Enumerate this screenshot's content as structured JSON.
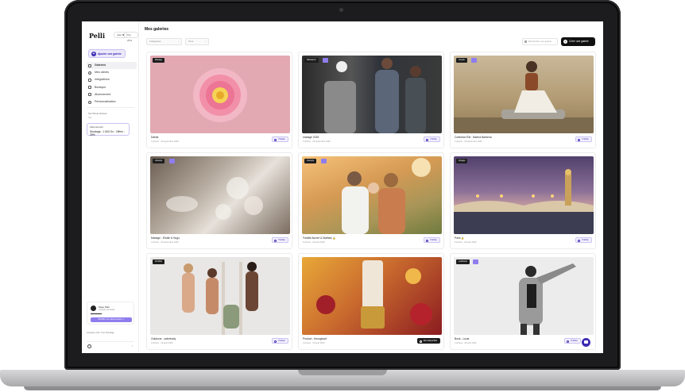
{
  "app": {
    "logo": "Pelli",
    "badge_1": "Aide ✱",
    "badge_2": "Top 25%"
  },
  "sidebar": {
    "add_gallery_label": "Ajouter une galerie",
    "items": [
      {
        "label": "Galeries",
        "icon": "gallery-icon",
        "active": true
      },
      {
        "label": "Mes clients",
        "icon": "users-icon",
        "active": false
      },
      {
        "label": "Intégrations",
        "icon": "plug-icon",
        "active": false
      },
      {
        "label": "Boutique",
        "icon": "shop-icon",
        "active": false
      },
      {
        "label": "Abonnement",
        "icon": "card-icon",
        "active": false
      },
      {
        "label": "Personnalisation",
        "icon": "palette-icon",
        "active": false
      }
    ],
    "storage_label": "Sur Photo Stories",
    "storage_value": "32 /",
    "plan_title": "Abonnement",
    "plan_text": "Stockage : 1 600 Go · Offres : 25%",
    "user_name": "Pepe Pelli",
    "user_sub": "Compte connecté",
    "upgrade_label": "Modifier mon abonnement ↗",
    "footer_text": "Accepter votre 1 Go Stockage",
    "help_chevron": "›"
  },
  "main": {
    "page_title": "Mes galeries",
    "filter_1": "Catégories",
    "filter_2": "Tous",
    "search_placeholder": "Rechercher une galerie",
    "create_label": "Créer une galerie"
  },
  "galleries": [
    {
      "title": "Dahlia",
      "meta": "4 photos · 19 septembre 2025",
      "tag": "Mariage",
      "status": "Publiée",
      "dark": false
    },
    {
      "title": "mariage 2025",
      "meta": "2 photos · 18 septembre 2025",
      "tag": "Naissance",
      "status": "Publiée",
      "dark": false
    },
    {
      "title": "Collection Été - Barbra Barbena",
      "meta": "4 photos · 18 septembre 2025",
      "tag": "Couple",
      "status": "Publiée",
      "dark": false
    },
    {
      "title": "Mariage - Élodie & Hugo",
      "meta": "4 photos · 18 septembre 2025",
      "tag": "Lifestyle",
      "status": "Publiée",
      "dark": false
    },
    {
      "title": "Famille Aurore & Mathieu 🔒",
      "meta": "6 photos · 18 août 2025",
      "tag": "Lifestyle",
      "status": "Publiée",
      "dark": false
    },
    {
      "title": "Paris 🔒",
      "meta": "6 photos · 28 août 2025",
      "tag": "Voyage",
      "status": "Publiée",
      "dark": false
    },
    {
      "title": "Outdoors - swimbody",
      "meta": "2 photos · 19 août 2025",
      "tag": "Portfolio",
      "status": "Publiée",
      "dark": false
    },
    {
      "title": "Product - throughout",
      "meta": "2 photos · 18 août 2025",
      "tag": "",
      "status": "Non-disponible",
      "dark": true
    },
    {
      "title": "Book - Lucia",
      "meta": "4 photos · 18 août 2025",
      "tag": "Lookbook",
      "status": "Publiée",
      "dark": false
    }
  ]
}
